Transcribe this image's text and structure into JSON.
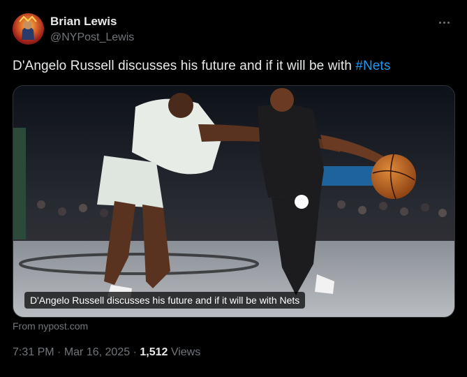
{
  "author": {
    "display_name": "Brian Lewis",
    "handle": "@NYPost_Lewis"
  },
  "tweet": {
    "text_prefix": "D'Angelo Russell discusses his future and if it will be with ",
    "hashtag": "#Nets"
  },
  "media": {
    "caption": "D'Angelo Russell discusses his future and if it will be with Nets",
    "source": "From nypost.com"
  },
  "meta": {
    "time": "7:31 PM",
    "separator": "·",
    "date": "Mar 16, 2025",
    "views_count": "1,512",
    "views_label": "Views"
  },
  "icons": {
    "more": "more-horizontal-icon"
  },
  "colors": {
    "background": "#000000",
    "text": "#e7e9ea",
    "secondary": "#71767b",
    "link": "#1d9bf0"
  }
}
